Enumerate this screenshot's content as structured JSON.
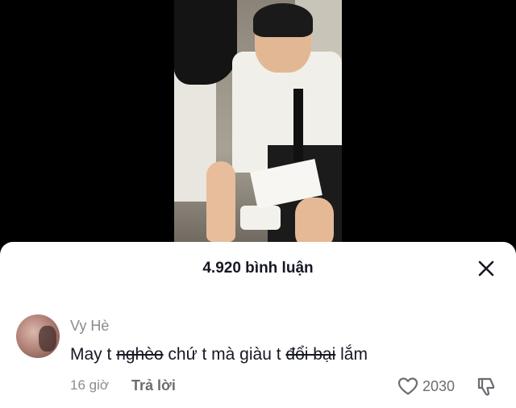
{
  "video": {
    "icon": "video-thumbnail"
  },
  "comments_sheet": {
    "title": "4.920 bình luận",
    "close_icon": "close-icon"
  },
  "comment": {
    "author": "Vy Hè",
    "text_parts": [
      {
        "text": "May t ",
        "struck": false
      },
      {
        "text": "nghèo",
        "struck": true
      },
      {
        "text": " chứ t mà giàu t ",
        "struck": false
      },
      {
        "text": "đổi bại",
        "struck": true
      },
      {
        "text": " lắm",
        "struck": false
      }
    ],
    "time": "16 giờ",
    "reply_label": "Trả lời",
    "like_count": "2030",
    "like_icon": "heart-outline-icon",
    "dislike_icon": "thumbs-down-icon"
  }
}
